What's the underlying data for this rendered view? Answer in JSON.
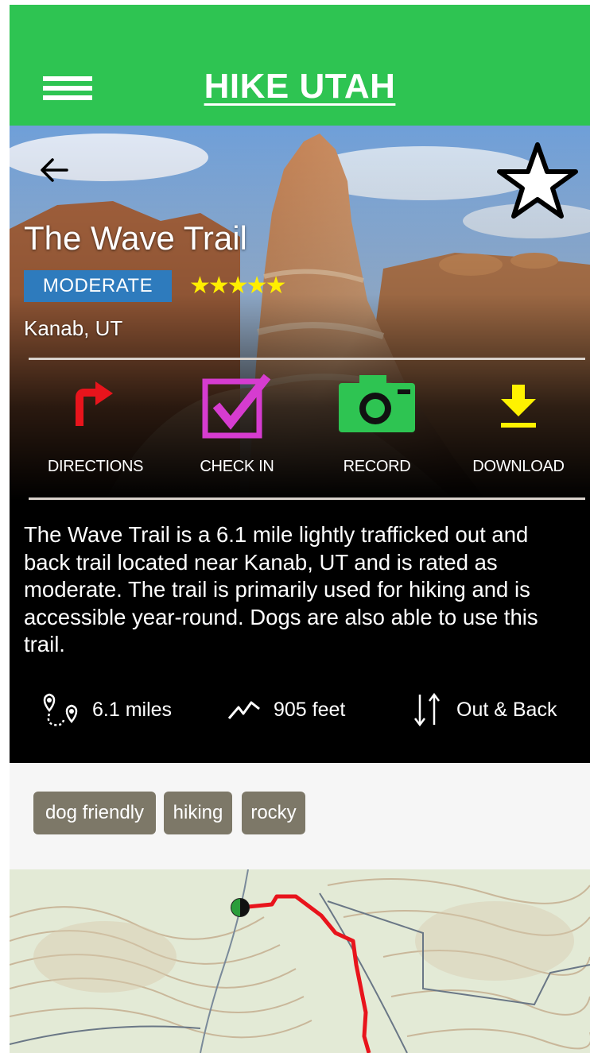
{
  "app": {
    "title": "HIKE UTAH"
  },
  "trail": {
    "name": "The Wave Trail",
    "difficulty": "MODERATE",
    "stars": "★★★★★",
    "rating": 5,
    "location": "Kanab, UT"
  },
  "actions": [
    {
      "label": "DIRECTIONS",
      "icon": "directions-icon",
      "color": "#e8141c"
    },
    {
      "label": "CHECK IN",
      "icon": "check-in-icon",
      "color": "#d63cd0"
    },
    {
      "label": "RECORD",
      "icon": "camera-icon",
      "color": "#2ec452"
    },
    {
      "label": "DOWNLOAD",
      "icon": "download-icon",
      "color": "#fff200"
    }
  ],
  "description": "The Wave Trail is a 6.1 mile lightly trafficked out and back trail located near Kanab, UT and is rated as moderate. The trail is primarily used for hiking and is accessible year-round. Dogs are also able to use this trail.",
  "stats": {
    "distance": "6.1 miles",
    "elevation": "905 feet",
    "route_type": "Out & Back"
  },
  "tags": [
    "dog friendly",
    "hiking",
    "rocky"
  ],
  "colors": {
    "header": "#2ec452",
    "difficulty_badge": "#2e7bbd",
    "tag": "#7d7868",
    "route": "#e8141c"
  }
}
